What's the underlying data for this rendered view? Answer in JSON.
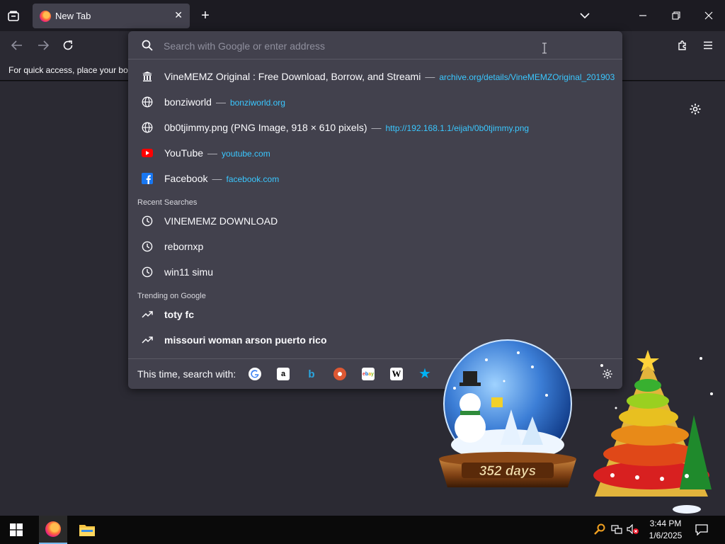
{
  "tab": {
    "title": "New Tab"
  },
  "bookmarks_bar": {
    "text": "For quick access, place your boo"
  },
  "urlbar": {
    "placeholder": "Search with Google or enter address"
  },
  "suggestions": [
    {
      "icon": "archive-icon",
      "title": "VineMEMZ Original : Free Download, Borrow, and Streami",
      "url": "archive.org/details/VineMEMZOriginal_201903"
    },
    {
      "icon": "globe-icon",
      "title": "bonziworld",
      "url": "bonziworld.org"
    },
    {
      "icon": "globe-icon",
      "title": "0b0tjimmy.png (PNG Image, 918 × 610 pixels)",
      "url": "http://192.168.1.1/eijah/0b0tjimmy.png"
    },
    {
      "icon": "youtube-icon",
      "title": "YouTube",
      "url": "youtube.com"
    },
    {
      "icon": "facebook-icon",
      "title": "Facebook",
      "url": "facebook.com"
    }
  ],
  "recent_searches": {
    "label": "Recent Searches",
    "items": [
      "VINEMEMZ DOWNLOAD",
      "rebornxp",
      "win11 simu"
    ]
  },
  "trending": {
    "label": "Trending on Google",
    "items": [
      "toty fc",
      "missouri woman arson puerto rico"
    ]
  },
  "separator": "—",
  "oneoff": {
    "label": "This time, search with:",
    "engines": [
      "google-icon",
      "amazon-icon",
      "bing-icon",
      "duckduckgo-icon",
      "ebay-icon",
      "wikipedia-icon",
      "bookmarks-star-icon"
    ]
  },
  "globe_gadget": {
    "counter": "352 days"
  },
  "taskbar": {
    "time": "3:44 PM",
    "date": "1/6/2025"
  }
}
